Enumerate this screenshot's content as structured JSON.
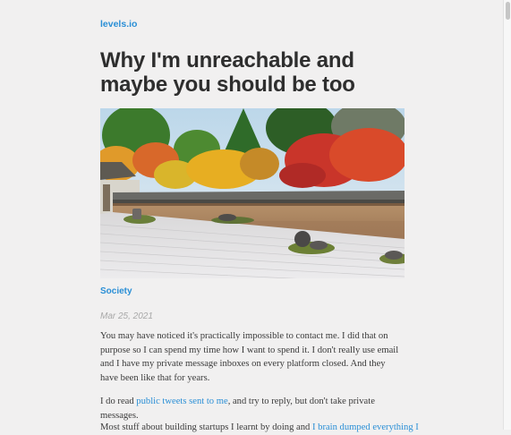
{
  "site": {
    "name": "levels.io"
  },
  "article": {
    "title": "Why I'm unreachable and maybe you should be too",
    "hero_image": {
      "description": "Zen rock garden"
    },
    "category": "Society",
    "date": "Mar 25, 2021",
    "paragraph1": "You may have noticed it's practically impossible to contact me. I did that on purpose so I can spend my time how I want to spend it. I don't really use email and I have my private message inboxes on every platform closed. And they have been like that for years.",
    "paragraph2": {
      "before": "I do read ",
      "link": "public tweets sent to me",
      "after": ", and try to reply, but don't take private messages."
    },
    "paragraph3": {
      "before": "Most stuff about building startups I learnt by doing and ",
      "link": "I brain dumped everything I"
    }
  }
}
